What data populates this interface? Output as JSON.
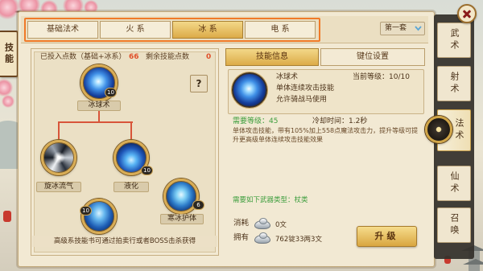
{
  "side_tab": {
    "label": "技能"
  },
  "school_tabs": [
    {
      "label": "基础法术"
    },
    {
      "label": "火 系"
    },
    {
      "label": "冰 系",
      "selected": true
    },
    {
      "label": "电 系"
    }
  ],
  "preset": {
    "value": "第一套",
    "icon": "chevron-down-icon"
  },
  "tree": {
    "invested_label": "已投入点数（基础+冰系）",
    "invested_value": "66",
    "remaining_label": "剩余技能点数",
    "remaining_value": "0",
    "help_label": "?",
    "skills": [
      {
        "name": "冰球术",
        "level": "10",
        "icon": "ice-orb-icon"
      },
      {
        "name": "旋冰流气",
        "icon": "ice-swirl-icon"
      },
      {
        "name": "液化",
        "level": "10",
        "icon": "liquefy-icon"
      },
      {
        "name": "寒冰护体",
        "level": "6",
        "icon": "ice-armor-icon"
      },
      {
        "level": "10",
        "icon": "ice-figure-icon"
      }
    ],
    "footer": "高级系技能书可通过拍卖行或者BOSS击杀获得"
  },
  "info_tabs": [
    {
      "label": "技能信息",
      "selected": true
    },
    {
      "label": "键位设置"
    }
  ],
  "detail": {
    "icon": "ice-orb-icon",
    "name": "冰球术",
    "level_label": "当前等级：",
    "level_value": "10/10",
    "tags": [
      "单体连续攻击技能",
      "允许骑战马使用"
    ],
    "req_level_label": "需要等级：",
    "req_level_value": "45",
    "cooldown_label": "冷却时间：",
    "cooldown_value": "1.2秒",
    "description": "单体攻击技能，带有105%加上558点魔法攻击力，提升等级可提升更高级单体连续攻击技能效果",
    "weapon_label": "需要如下武器类型：",
    "weapon_value": "杖类",
    "cost_label": "消耗",
    "cost_value": "0文",
    "own_label": "拥有",
    "own_value": "762锭33两3文",
    "currency_icon": "silver-ingot-icon",
    "upgrade_label": "升级"
  },
  "class_tabs": [
    {
      "label": "武术"
    },
    {
      "label": "射术"
    },
    {
      "label": "法术",
      "selected": true
    },
    {
      "label": "仙术"
    },
    {
      "label": "召唤"
    }
  ],
  "colors": {
    "accent": "#f07a28",
    "selected_tab": "#e6c062",
    "connector": "#d8553a",
    "green_text": "#3e9e3e",
    "count_highlight": "#e0502a"
  }
}
